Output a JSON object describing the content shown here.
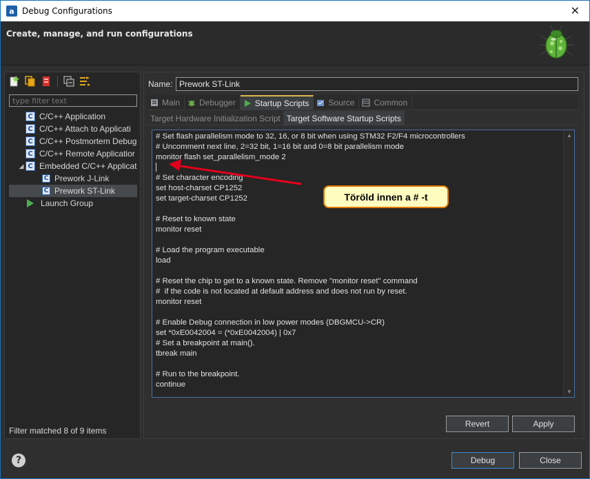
{
  "window": {
    "title": "Debug Configurations",
    "close_glyph": "✕"
  },
  "header": {
    "title": "Create, manage, and run configurations"
  },
  "left": {
    "filter_placeholder": "type filter text",
    "tree": [
      {
        "label": "C/C++ Application",
        "icon": "c-config-icon",
        "level": 1
      },
      {
        "label": "C/C++ Attach to Applicati",
        "icon": "c-config-icon",
        "level": 1
      },
      {
        "label": "C/C++ Postmortem Debug",
        "icon": "c-config-icon",
        "level": 1
      },
      {
        "label": "C/C++ Remote Applicatior",
        "icon": "c-config-icon",
        "level": 1
      },
      {
        "label": "Embedded C/C++ Applicat",
        "icon": "c-config-icon",
        "level": 1,
        "expanded": true
      },
      {
        "label": "Prework J-Link",
        "icon": "c-file-icon",
        "level": 2
      },
      {
        "label": "Prework ST-Link",
        "icon": "c-file-icon",
        "level": 2,
        "selected": true
      },
      {
        "label": "Launch Group",
        "icon": "launch-icon",
        "level": 1
      }
    ],
    "filter_status": "Filter matched 8 of 9 items"
  },
  "right": {
    "name_label": "Name:",
    "name_value": "Prework ST-Link",
    "tabs": [
      "Main",
      "Debugger",
      "Startup Scripts",
      "Source",
      "Common"
    ],
    "active_tab": "Startup Scripts",
    "subtabs": [
      "Target Hardware Initialization Script",
      "Target Software Startup Scripts"
    ],
    "active_subtab": "Target Software Startup Scripts",
    "script_lines": [
      "# Set flash parallelism mode to 32, 16, or 8 bit when using STM32 F2/F4 microcontrollers",
      "# Uncomment next line, 2=32 bit, 1=16 bit and 0=8 bit parallelism mode",
      "monitor flash set_parallelism_mode 2",
      "",
      "# Set character encoding",
      "set host-charset CP1252",
      "set target-charset CP1252",
      "",
      "# Reset to known state",
      "monitor reset",
      "",
      "# Load the program executable",
      "load",
      "",
      "# Reset the chip to get to a known state. Remove \"monitor reset\" command",
      "#  if the code is not located at default address and does not run by reset.",
      "monitor reset",
      "",
      "# Enable Debug connection in low power modes (DBGMCU->CR)",
      "set *0xE0042004 = (*0xE0042004) | 0x7",
      "# Set a breakpoint at main().",
      "tbreak main",
      "",
      "# Run to the breakpoint.",
      "continue"
    ],
    "revert_label": "Revert",
    "apply_label": "Apply"
  },
  "annotation": {
    "callout_text": "Töröld innen a # -t",
    "color": "#e3001b"
  },
  "footer": {
    "debug_label": "Debug",
    "close_label": "Close",
    "help_glyph": "?"
  }
}
